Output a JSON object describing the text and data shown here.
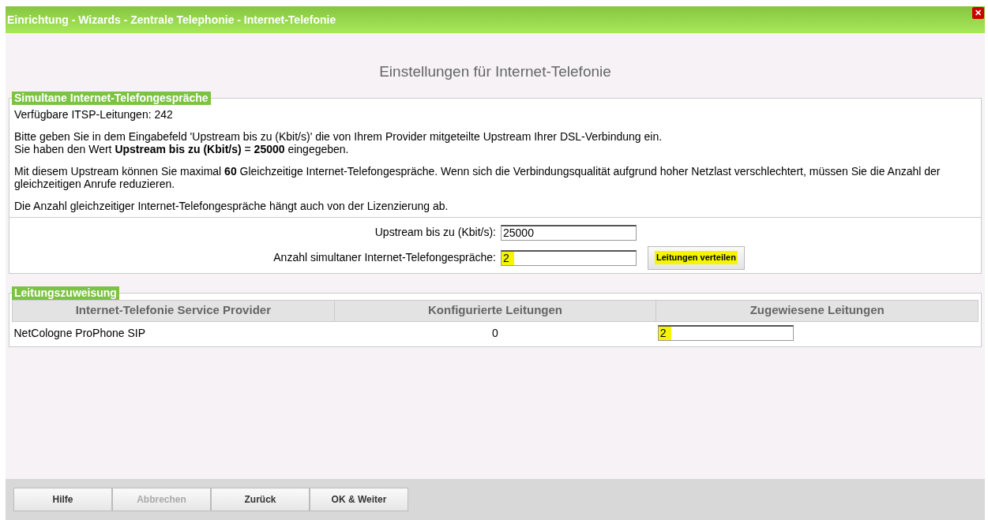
{
  "window": {
    "title": "Einrichtung - Wizards - Zentrale Telephonie - Internet-Telefonie",
    "close": "✕"
  },
  "heading": "Einstellungen für Internet-Telefonie",
  "section1": {
    "legend": "Simultane Internet-Telefongespräche",
    "paragraphs": [
      "Verfügbare ITSP-Leitungen: 242",
      "Bitte geben Sie in dem Eingabefeld 'Upstream bis zu (Kbit/s)' die von Ihrem Provider mitgeteilte Upstream Ihrer DSL-Verbindung ein.\nSie haben den Wert **Upstream bis zu (Kbit/s)** = **25000** eingegeben.",
      "Mit diesem Upstream können Sie maximal **60** Gleichzeitige Internet-Telefongespräche. Wenn sich die Verbindungsqualität aufgrund hoher Netzlast verschlechtert, müssen Sie die Anzahl der gleichzeitigen Anrufe reduzieren.",
      "Die Anzahl gleichzeitiger Internet-Telefongespräche hängt auch von der Lizenzierung ab."
    ],
    "fields": [
      {
        "label": "Upstream bis zu (Kbit/s):",
        "value": "25000",
        "highlighted": false
      },
      {
        "label": "Anzahl simultaner Internet-Telefongespräche:",
        "value": "2",
        "highlighted": true,
        "button": {
          "label": "Leitungen verteilen",
          "highlighted": true
        }
      }
    ]
  },
  "section2": {
    "legend": "Leitungszuweisung",
    "columns": [
      "Internet-Telefonie Service Provider",
      "Konfigurierte Leitungen",
      "Zugewiesene Leitungen"
    ],
    "rows": [
      {
        "provider": "NetCologne ProPhone SIP",
        "configured": "0",
        "assigned": "2",
        "highlighted": true
      }
    ]
  },
  "buttons": [
    {
      "label": "Hilfe",
      "disabled": false
    },
    {
      "label": "Abbrechen",
      "disabled": true
    },
    {
      "label": "Zurück",
      "disabled": false
    },
    {
      "label": "OK & Weiter",
      "disabled": false
    }
  ]
}
